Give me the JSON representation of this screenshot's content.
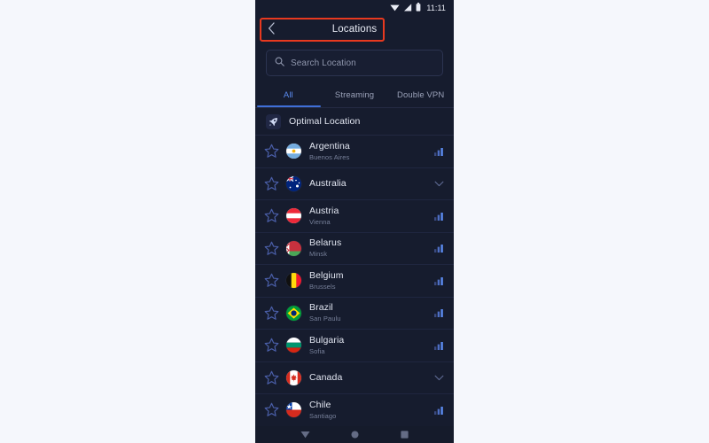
{
  "colors": {
    "page_background": "#f5f7fc",
    "app_background": "#161c2e",
    "accent": "#3f6fd8",
    "highlight_box": "#e8391f",
    "primary_text": "#e3e7f2",
    "secondary_text": "#77809a"
  },
  "status_bar": {
    "time": "11:11",
    "icons": [
      "wifi-icon",
      "cellular-signal-icon",
      "battery-icon"
    ]
  },
  "title_bar": {
    "back_icon": "chevron-left-icon",
    "title": "Locations",
    "highlighted": true
  },
  "search": {
    "icon": "search-icon",
    "placeholder": "Search Location",
    "value": ""
  },
  "tabs": {
    "items": [
      {
        "label": "All",
        "active": true
      },
      {
        "label": "Streaming",
        "active": false
      },
      {
        "label": "Double VPN",
        "active": false
      }
    ]
  },
  "optimal": {
    "icon": "rocket-icon",
    "label": "Optimal Location"
  },
  "locations": [
    {
      "country": "Argentina",
      "city": "Buenos Aires",
      "flag": "ar",
      "right_icon": "signal-bars-icon",
      "favorite": false
    },
    {
      "country": "Australia",
      "city": "",
      "flag": "au",
      "right_icon": "chevron-down-icon",
      "favorite": false
    },
    {
      "country": "Austria",
      "city": "Vienna",
      "flag": "at",
      "right_icon": "signal-bars-icon",
      "favorite": false
    },
    {
      "country": "Belarus",
      "city": "Minsk",
      "flag": "by",
      "right_icon": "signal-bars-icon",
      "favorite": false
    },
    {
      "country": "Belgium",
      "city": "Brussels",
      "flag": "be",
      "right_icon": "signal-bars-icon",
      "favorite": false
    },
    {
      "country": "Brazil",
      "city": "San Paulu",
      "flag": "br",
      "right_icon": "signal-bars-icon",
      "favorite": false
    },
    {
      "country": "Bulgaria",
      "city": "Sofia",
      "flag": "bg",
      "right_icon": "signal-bars-icon",
      "favorite": false
    },
    {
      "country": "Canada",
      "city": "",
      "flag": "ca",
      "right_icon": "chevron-down-icon",
      "favorite": false
    },
    {
      "country": "Chile",
      "city": "Santiago",
      "flag": "cl",
      "right_icon": "signal-bars-icon",
      "favorite": false
    }
  ],
  "nav_bar": {
    "buttons": [
      "back-triangle-icon",
      "home-circle-icon",
      "recents-square-icon"
    ]
  }
}
